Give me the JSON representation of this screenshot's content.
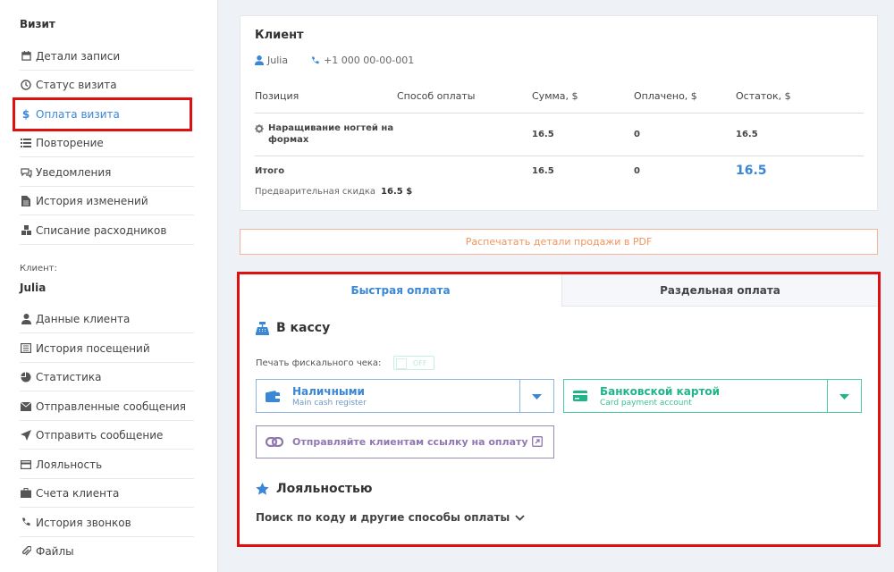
{
  "sidebar": {
    "visit_heading": "Визит",
    "visit_items": [
      {
        "label": "Детали записи",
        "icon": "calendar-icon"
      },
      {
        "label": "Статус визита",
        "icon": "clock-icon"
      },
      {
        "label": "Оплата визита",
        "icon": "dollar-icon"
      },
      {
        "label": "Повторение",
        "icon": "list-icon"
      },
      {
        "label": "Уведомления",
        "icon": "chat-icon"
      },
      {
        "label": "История изменений",
        "icon": "document-icon"
      },
      {
        "label": "Списание расходников",
        "icon": "cubes-icon"
      }
    ],
    "client_caption": "Клиент:",
    "client_name": "Julia",
    "client_items": [
      {
        "label": "Данные клиента",
        "icon": "user-icon"
      },
      {
        "label": "История посещений",
        "icon": "list-alt-icon"
      },
      {
        "label": "Статистика",
        "icon": "pie-chart-icon"
      },
      {
        "label": "Отправленные сообщения",
        "icon": "envelope-icon"
      },
      {
        "label": "Отправить сообщение",
        "icon": "send-icon"
      },
      {
        "label": "Лояльность",
        "icon": "card-icon"
      },
      {
        "label": "Счета клиента",
        "icon": "briefcase-icon"
      },
      {
        "label": "История звонков",
        "icon": "phone-icon"
      },
      {
        "label": "Файлы",
        "icon": "paperclip-icon"
      }
    ]
  },
  "client_card": {
    "title": "Клиент",
    "name": "Julia",
    "phone": "+1 000 00-00-001",
    "columns": [
      "Позиция",
      "Способ оплаты",
      "Сумма, $",
      "Оплачено, $",
      "Остаток, $"
    ],
    "row": {
      "position": "Наращивание ногтей на формах",
      "method": "",
      "sum": "16.5",
      "paid": "0",
      "remain": "16.5"
    },
    "total": {
      "label": "Итого",
      "sum": "16.5",
      "paid": "0",
      "remain": "16.5"
    },
    "discount_label": "Предварительная скидка",
    "discount_value": "16.5 $"
  },
  "pdf_button": "Распечатать детали продажи в PDF",
  "payment": {
    "tabs": [
      "Быстрая оплата",
      "Раздельная оплата"
    ],
    "cash_section_title": "В кассу",
    "fiscal_label": "Печать фискального чека:",
    "fiscal_toggle": "OFF",
    "cash_option": {
      "label": "Наличными",
      "sub": "Main cash register"
    },
    "card_option": {
      "label": "Банковской картой",
      "sub": "Card payment account"
    },
    "link_button": "Отправляйте клиентам ссылку на оплату",
    "loyalty_title": "Лояльностью",
    "loyalty_search": "Поиск по коду и другие способы оплаты"
  },
  "colors": {
    "accent": "#3a87d6",
    "green": "#1fb58a",
    "purple": "#8f77b0",
    "orange": "#f0955f",
    "highlight": "#e01010"
  }
}
